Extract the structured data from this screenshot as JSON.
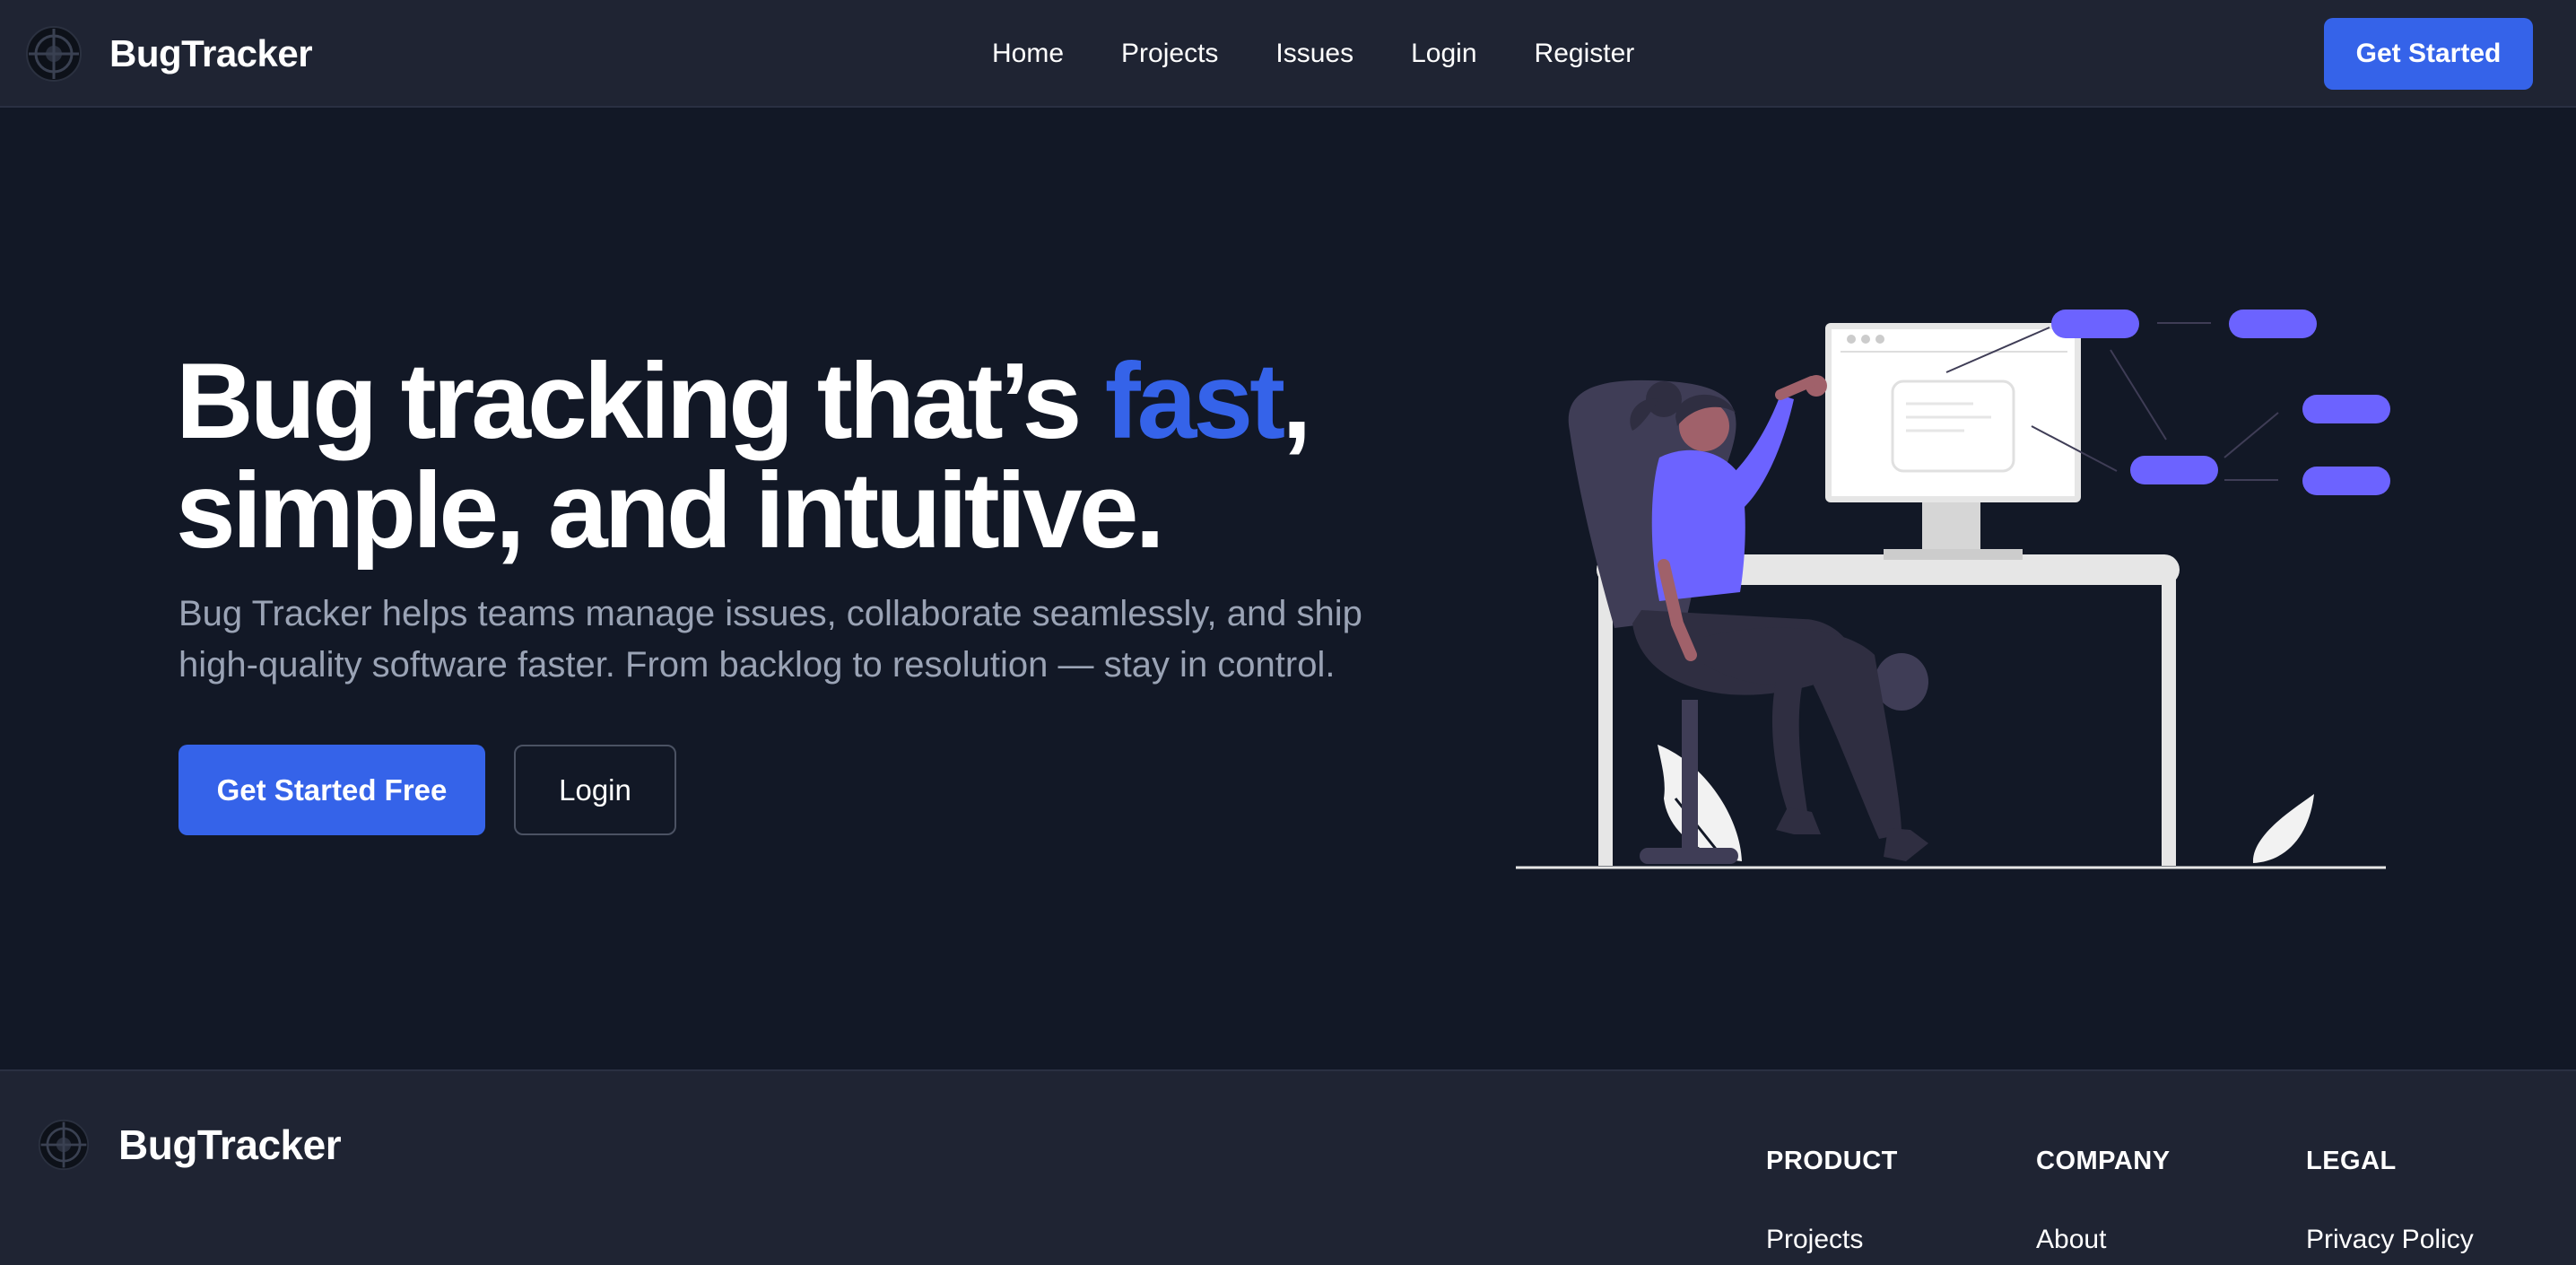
{
  "brand": {
    "name": "BugTracker",
    "logo_icon": "bug-target-icon"
  },
  "nav": {
    "links": [
      "Home",
      "Projects",
      "Issues",
      "Login",
      "Register"
    ],
    "cta_label": "Get Started"
  },
  "hero": {
    "title_part1": "Bug tracking that’s ",
    "title_accent": "fast",
    "title_part2": ",",
    "title_line2": "simple, and intuitive.",
    "subtitle": "Bug Tracker helps teams manage issues, collaborate seamlessly, and ship high-quality software faster. From backlog to resolution — stay in control.",
    "primary_button": "Get Started Free",
    "secondary_button": "Login",
    "illustration": "person-at-computer-illustration"
  },
  "footer": {
    "brand_name": "BugTracker",
    "columns": [
      {
        "heading": "PRODUCT",
        "links": [
          "Projects"
        ]
      },
      {
        "heading": "COMPANY",
        "links": [
          "About"
        ]
      },
      {
        "heading": "LEGAL",
        "links": [
          "Privacy Policy"
        ]
      }
    ]
  },
  "colors": {
    "background": "#121826",
    "surface": "#1f2433",
    "accent": "#3563e9",
    "muted_text": "#9aa3b5",
    "illustration_purple": "#6c63ff"
  }
}
